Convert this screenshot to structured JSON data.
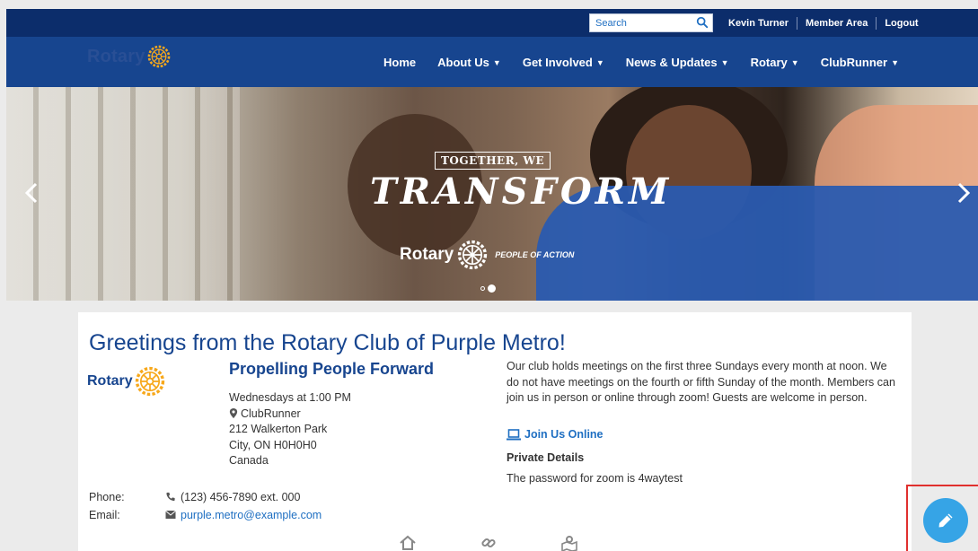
{
  "topbar": {
    "search_placeholder": "Search",
    "links": [
      "Kevin Turner",
      "Member Area",
      "Logout"
    ]
  },
  "navbar": {
    "logo_text": "Rotary",
    "items": [
      "Home",
      "About Us",
      "Get Involved",
      "News & Updates",
      "Rotary",
      "ClubRunner"
    ]
  },
  "hero": {
    "headline_small": "TOGETHER, WE",
    "headline_big": "TRANSFORM",
    "brand": "Rotary",
    "tagline": "PEOPLE OF ACTION",
    "slide_count": 2,
    "active_slide": 2
  },
  "content": {
    "greeting": "Greetings from the Rotary Club of Purple Metro!",
    "logo_text": "Rotary",
    "tagline": "Propelling People Forward",
    "meeting_time": "Wednesdays at 1:00 PM",
    "location_name": "ClubRunner",
    "address1": "212 Walkerton Park",
    "address2": "City, ON H0H0H0",
    "country": "Canada",
    "phone_label": "Phone:",
    "phone": "(123) 456-7890  ext. 000",
    "email_label": "Email:",
    "email": "purple.metro@example.com",
    "about": "Our club holds meetings on the first three Sundays every month at noon. We do not have meetings on the fourth or fifth Sunday of the month. Members can join us in person or online through zoom! Guests are welcome in person.",
    "join_label": "Join Us Online",
    "private_heading": "Private Details",
    "private_text": "The password for zoom is 4waytest"
  },
  "colors": {
    "topbar": "#0c2d6b",
    "navbar": "#17458f",
    "link": "#1f6fc2",
    "gold": "#f7a81b",
    "fab": "#36a4e6",
    "highlight": "#e0302e"
  }
}
